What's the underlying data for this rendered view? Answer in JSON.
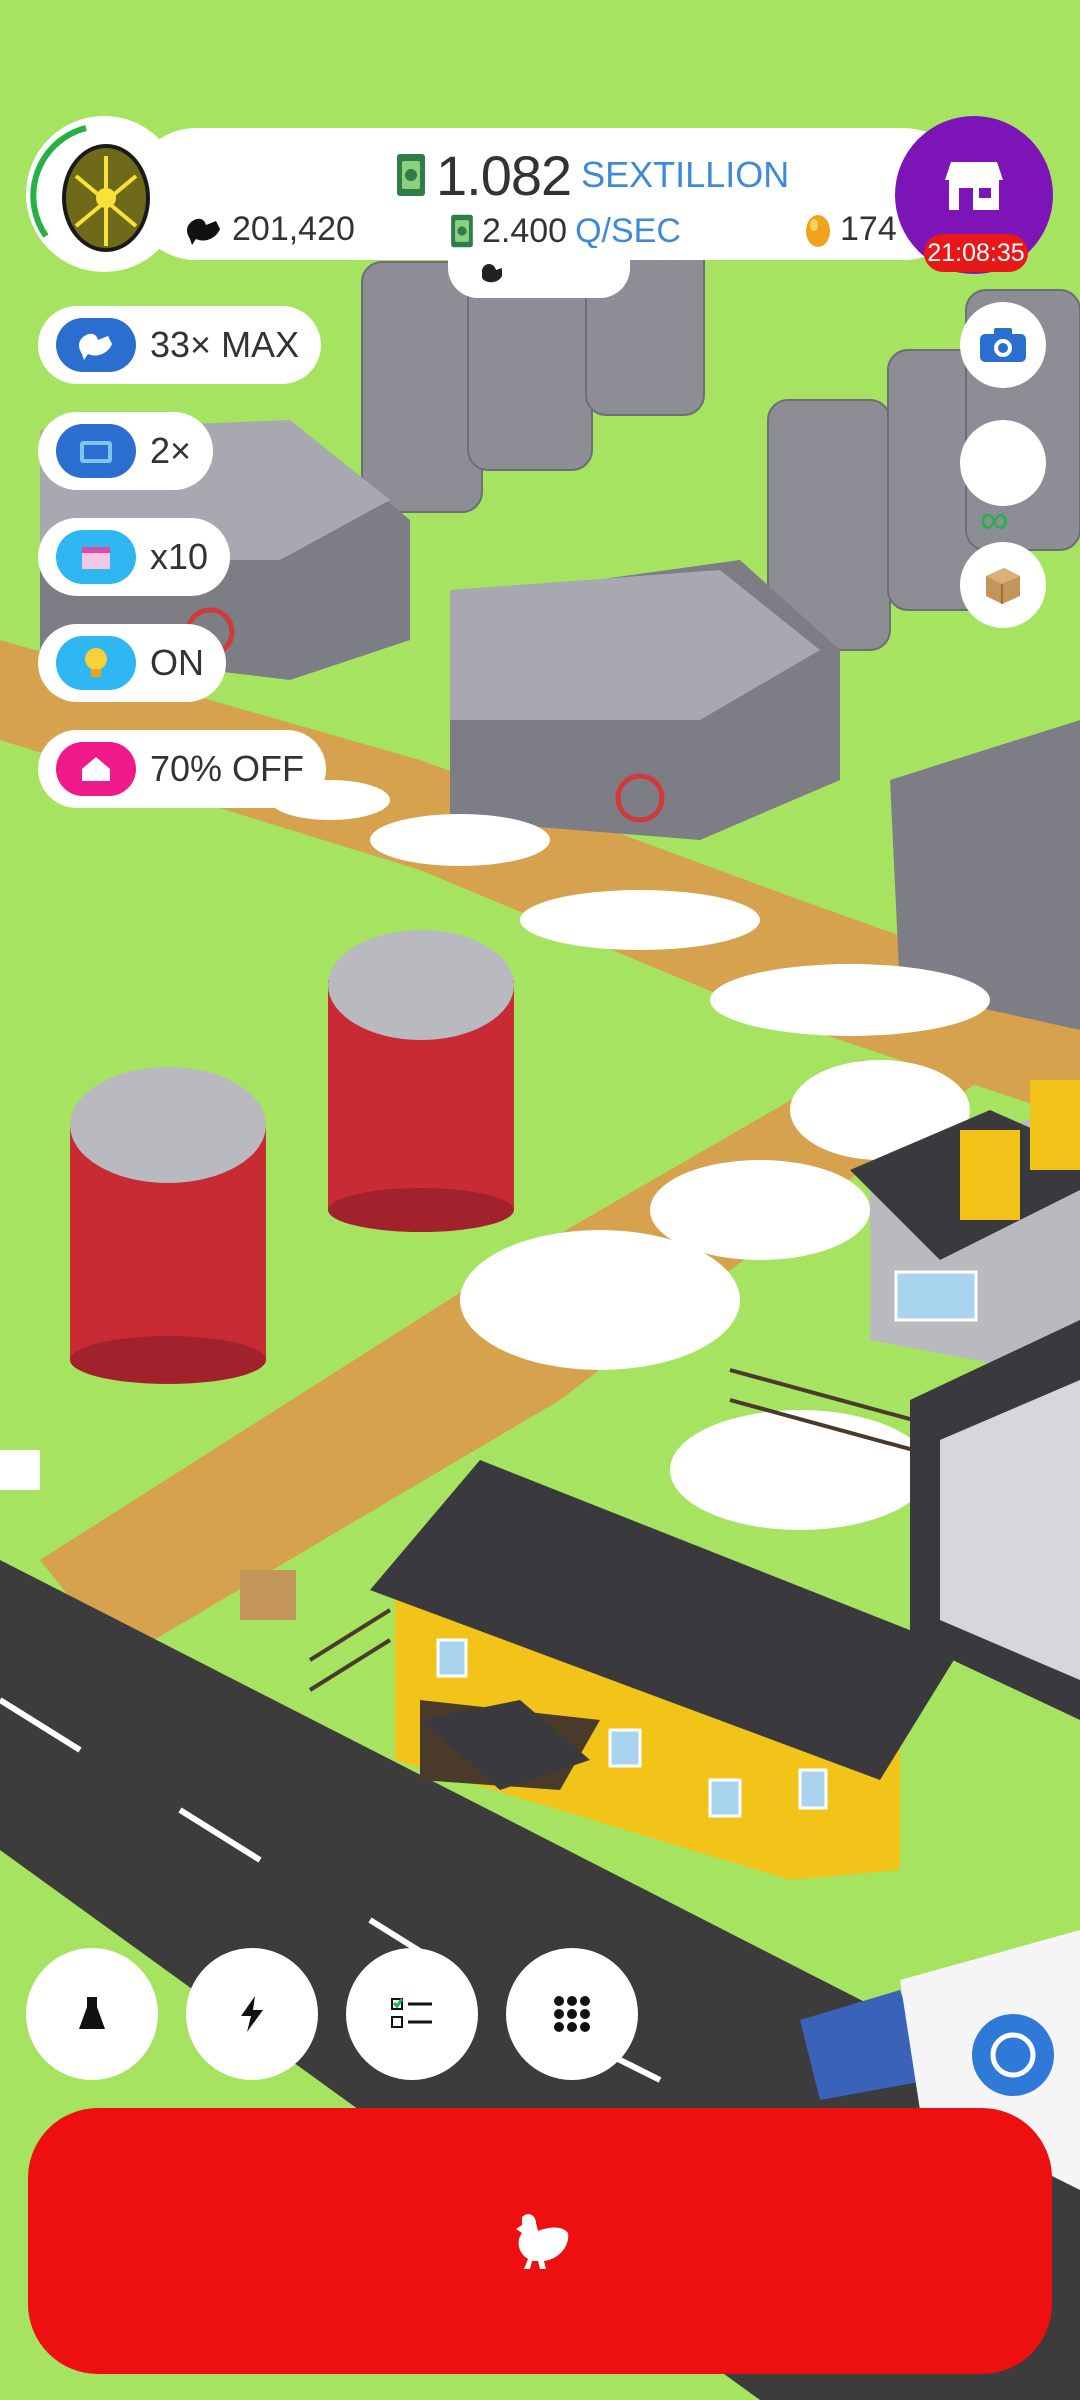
{
  "hud": {
    "money_value": "1.082",
    "money_unit": "SEXTILLION",
    "rate_value": "2.400",
    "rate_unit": "Q/SEC",
    "chicken_count": "201,420",
    "golden_eggs": "174",
    "shop_timer": "21:08:35",
    "infinity": "∞"
  },
  "boosts": [
    {
      "label": "33× MAX",
      "icon": "chicken-icon",
      "color": "#2a6fd0"
    },
    {
      "label": "2×",
      "icon": "tv-icon",
      "color": "#2a6fd0"
    },
    {
      "label": "x10",
      "icon": "box-icon",
      "color": "#2eb7f0"
    },
    {
      "label": "ON",
      "icon": "lightbulb-icon",
      "color": "#2eb7f0"
    },
    {
      "label": "70% OFF",
      "icon": "house-icon",
      "color": "#ee1a8a"
    }
  ],
  "right_buttons": [
    "camera-icon",
    "blank",
    "crate-icon"
  ],
  "bottom_buttons": [
    "flask-icon",
    "lightning-icon",
    "checklist-icon",
    "grid-icon"
  ],
  "colors": {
    "grass": "#a5e360",
    "road": "#3c3c3c",
    "path": "#d6a24e",
    "hatch": "#ee0f10",
    "shop": "#7d14b8"
  }
}
